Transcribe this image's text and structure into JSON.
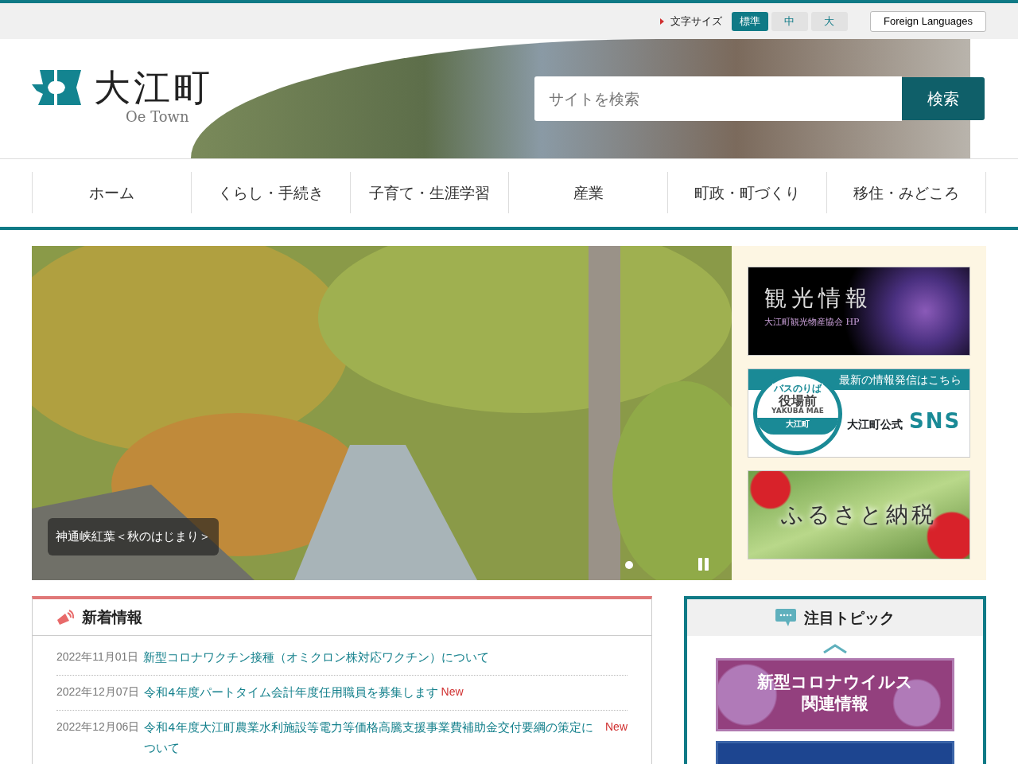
{
  "font_size": {
    "label": "文字サイズ",
    "options": [
      {
        "label": "標準",
        "selected": true
      },
      {
        "label": "中",
        "selected": false
      },
      {
        "label": "大",
        "selected": false
      }
    ]
  },
  "foreign_languages": "Foreign Languages",
  "logo": {
    "name": "大江町",
    "subtitle": "Oe Town"
  },
  "search": {
    "placeholder": "サイトを検索",
    "button": "検索"
  },
  "nav": [
    {
      "label": "ホーム"
    },
    {
      "label": "くらし・手続き"
    },
    {
      "label": "子育て・生涯学習"
    },
    {
      "label": "産業"
    },
    {
      "label": "町政・町づくり"
    },
    {
      "label": "移住・みどころ"
    }
  ],
  "slideshow": {
    "caption": "神通峡紅葉＜秋のはじまり＞",
    "dots": [
      {
        "selected": true
      }
    ]
  },
  "banners": [
    {
      "kind": "tourism",
      "title": "観光情報",
      "subtitle": "大江町観光物産協会 HP"
    },
    {
      "kind": "sns",
      "header": "最新の情報発信はこちら",
      "stop_top": "バスのりば",
      "stop_name": "役場前",
      "stop_roman": "YAKUBA MAE",
      "stop_town": "大江町",
      "text": "大江町公式",
      "big": "SNS"
    },
    {
      "kind": "furusato",
      "title": "ふるさと納税"
    }
  ],
  "news": {
    "title": "新着情報",
    "items": [
      {
        "date": "2022年11月01日",
        "title": "新型コロナワクチン接種（オミクロン株対応ワクチン）について"
      },
      {
        "date": "2022年12月07日",
        "title": "令和4年度パートタイム会計年度任用職員を募集します",
        "badge": "New"
      },
      {
        "date": "2022年12月06日",
        "title": "令和4年度大江町農業水利施設等電力等価格高騰支援事業費補助金交付要綱の策定について",
        "badge": "New"
      }
    ]
  },
  "topics": {
    "title": "注目トピック",
    "banners": [
      {
        "kind": "corona",
        "lines": [
          "新型コロナウイルス",
          "関連情報"
        ]
      },
      {
        "kind": "blank"
      }
    ]
  }
}
